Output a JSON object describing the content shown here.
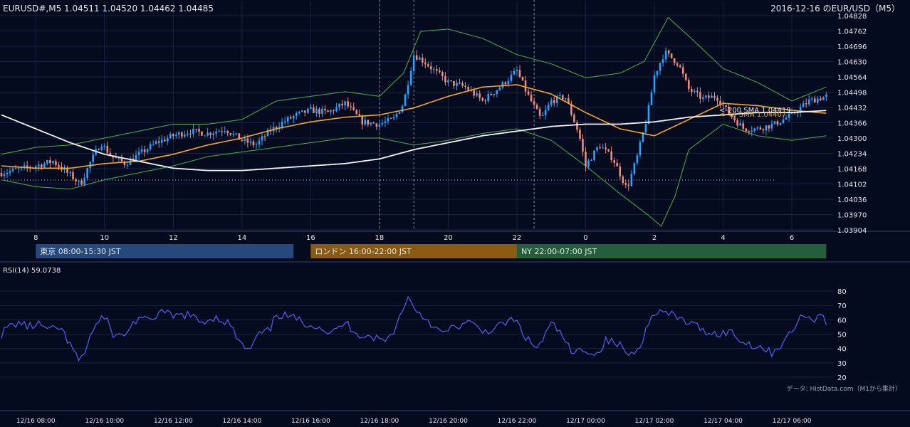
{
  "header": {
    "left": "EURUSD#,M5 1.04511 1.04520 1.04462 1.04485",
    "right": "2016-12-16 のEUR/USD（M5）"
  },
  "colors": {
    "bg": "#050b1f",
    "grid": "#1a2240",
    "bull": "#29a3ff",
    "bear": "#f08a7a",
    "sma200": "#f2f2f2",
    "sma40": "#f5a623",
    "boll": "#4caf50",
    "rsi": "#5560f0",
    "tokyo": "#24497a",
    "london": "#8a5a12",
    "ny": "#255e3a"
  },
  "sessions": [
    {
      "label": "東京 08:00-15:30 JST",
      "start": 8.0,
      "end": 15.5,
      "color": "#24497a"
    },
    {
      "label": "ロンドン 16:00-22:00 JST",
      "start": 16.0,
      "end": 22.0,
      "color": "#8a5a12"
    },
    {
      "label": "NY 22:00-07:00 JST",
      "start": 22.0,
      "end": 31.0,
      "color": "#255e3a"
    }
  ],
  "footer_note": "データ: HistData.com（M1から集計）",
  "chart_data": [
    {
      "type": "candlestick",
      "title": "EURUSD#,M5 1.04511 1.04520 1.04462 1.04485",
      "subtitle": "2016-12-16 のEUR/USD（M5）",
      "x_ticks": [
        "8",
        "10",
        "12",
        "14",
        "16",
        "18",
        "20",
        "22",
        "0",
        "2",
        "4",
        "6"
      ],
      "x_tick_hours": [
        8,
        10,
        12,
        14,
        16,
        18,
        20,
        22,
        24,
        26,
        28,
        30
      ],
      "xlim_hours": [
        7.0,
        31.2
      ],
      "y_ticks": [
        "1.04828",
        "1.04762",
        "1.04696",
        "1.04630",
        "1.04564",
        "1.04498",
        "1.04432",
        "1.04366",
        "1.04300",
        "1.04234",
        "1.04168",
        "1.04102",
        "1.04036",
        "1.03970",
        "1.03904"
      ],
      "ylim": [
        1.03904,
        1.04828
      ],
      "sma_labels": [
        "<-200 SMA 1.04419",
        "<-40 SMA 1.04407"
      ],
      "last_close": 1.04485,
      "dotted_level": 1.04119,
      "vlines_dashed": [
        18.0,
        19.0,
        22.5
      ],
      "price_path": [
        [
          7.0,
          1.0415
        ],
        [
          8.0,
          1.0418
        ],
        [
          8.5,
          1.042
        ],
        [
          9.0,
          1.0414
        ],
        [
          9.3,
          1.041
        ],
        [
          9.6,
          1.042
        ],
        [
          9.9,
          1.0428
        ],
        [
          10.2,
          1.0422
        ],
        [
          10.6,
          1.0419
        ],
        [
          11.0,
          1.0423
        ],
        [
          11.5,
          1.0428
        ],
        [
          12.0,
          1.0431
        ],
        [
          12.5,
          1.0433
        ],
        [
          13.0,
          1.0432
        ],
        [
          13.5,
          1.0434
        ],
        [
          14.0,
          1.0429
        ],
        [
          14.4,
          1.0427
        ],
        [
          14.8,
          1.0433
        ],
        [
          15.2,
          1.0437
        ],
        [
          15.6,
          1.044
        ],
        [
          16.0,
          1.0442
        ],
        [
          16.5,
          1.0441
        ],
        [
          17.0,
          1.0445
        ],
        [
          17.5,
          1.0437
        ],
        [
          18.0,
          1.0436
        ],
        [
          18.4,
          1.0438
        ],
        [
          18.7,
          1.0445
        ],
        [
          19.0,
          1.0466
        ],
        [
          19.3,
          1.0463
        ],
        [
          19.6,
          1.0459
        ],
        [
          20.0,
          1.0454
        ],
        [
          20.5,
          1.0452
        ],
        [
          21.0,
          1.0446
        ],
        [
          21.5,
          1.0452
        ],
        [
          22.0,
          1.0459
        ],
        [
          22.3,
          1.0449
        ],
        [
          22.7,
          1.0438
        ],
        [
          23.0,
          1.0446
        ],
        [
          23.4,
          1.0448
        ],
        [
          23.8,
          1.0432
        ],
        [
          24.0,
          1.0418
        ],
        [
          24.4,
          1.0427
        ],
        [
          24.8,
          1.0421
        ],
        [
          25.2,
          1.0408
        ],
        [
          25.5,
          1.0422
        ],
        [
          25.8,
          1.044
        ],
        [
          26.0,
          1.0457
        ],
        [
          26.3,
          1.0467
        ],
        [
          26.7,
          1.0462
        ],
        [
          27.0,
          1.0451
        ],
        [
          27.4,
          1.0447
        ],
        [
          27.8,
          1.0448
        ],
        [
          28.2,
          1.044
        ],
        [
          28.6,
          1.0434
        ],
        [
          29.0,
          1.0434
        ],
        [
          29.5,
          1.0436
        ],
        [
          30.0,
          1.044
        ],
        [
          30.5,
          1.0446
        ],
        [
          31.0,
          1.0448
        ]
      ],
      "sma200_path": [
        [
          7.0,
          1.044
        ],
        [
          8.0,
          1.0434
        ],
        [
          9.0,
          1.0428
        ],
        [
          10.0,
          1.0423
        ],
        [
          11.0,
          1.042
        ],
        [
          12.0,
          1.0417
        ],
        [
          13.0,
          1.0416
        ],
        [
          14.0,
          1.0416
        ],
        [
          15.0,
          1.0417
        ],
        [
          16.0,
          1.0418
        ],
        [
          17.0,
          1.0419
        ],
        [
          18.0,
          1.0421
        ],
        [
          19.0,
          1.0425
        ],
        [
          20.0,
          1.0428
        ],
        [
          21.0,
          1.0431
        ],
        [
          22.0,
          1.0433
        ],
        [
          23.0,
          1.0435
        ],
        [
          24.0,
          1.0436
        ],
        [
          25.0,
          1.0436
        ],
        [
          26.0,
          1.0437
        ],
        [
          27.0,
          1.0439
        ],
        [
          28.0,
          1.044
        ],
        [
          29.0,
          1.0441
        ],
        [
          30.0,
          1.0441
        ],
        [
          31.0,
          1.04419
        ]
      ],
      "sma40_path": [
        [
          7.0,
          1.0418
        ],
        [
          8.0,
          1.0417
        ],
        [
          9.0,
          1.0417
        ],
        [
          10.0,
          1.0419
        ],
        [
          11.0,
          1.042
        ],
        [
          12.0,
          1.0423
        ],
        [
          13.0,
          1.0427
        ],
        [
          14.0,
          1.043
        ],
        [
          15.0,
          1.0434
        ],
        [
          16.0,
          1.0437
        ],
        [
          17.0,
          1.0439
        ],
        [
          18.0,
          1.044
        ],
        [
          19.0,
          1.0443
        ],
        [
          20.0,
          1.0448
        ],
        [
          21.0,
          1.0452
        ],
        [
          22.0,
          1.0453
        ],
        [
          23.0,
          1.0449
        ],
        [
          24.0,
          1.0441
        ],
        [
          25.0,
          1.0434
        ],
        [
          26.0,
          1.0431
        ],
        [
          27.0,
          1.0438
        ],
        [
          28.0,
          1.0445
        ],
        [
          29.0,
          1.0444
        ],
        [
          30.0,
          1.0442
        ],
        [
          31.0,
          1.04407
        ]
      ],
      "boll_upper_path": [
        [
          7.0,
          1.0423
        ],
        [
          8.0,
          1.0426
        ],
        [
          9.0,
          1.0427
        ],
        [
          10.0,
          1.043
        ],
        [
          11.0,
          1.0433
        ],
        [
          12.0,
          1.0436
        ],
        [
          13.0,
          1.0436
        ],
        [
          14.0,
          1.0438
        ],
        [
          15.0,
          1.0446
        ],
        [
          16.0,
          1.0448
        ],
        [
          17.0,
          1.045
        ],
        [
          18.0,
          1.0448
        ],
        [
          18.7,
          1.0458
        ],
        [
          19.2,
          1.0476
        ],
        [
          20.0,
          1.0477
        ],
        [
          21.0,
          1.0473
        ],
        [
          22.0,
          1.0466
        ],
        [
          23.0,
          1.0462
        ],
        [
          24.0,
          1.0456
        ],
        [
          25.0,
          1.0458
        ],
        [
          25.7,
          1.0463
        ],
        [
          26.4,
          1.0482
        ],
        [
          27.0,
          1.0474
        ],
        [
          28.0,
          1.046
        ],
        [
          29.0,
          1.0454
        ],
        [
          30.0,
          1.0446
        ],
        [
          31.0,
          1.0452
        ]
      ],
      "boll_lower_path": [
        [
          7.0,
          1.0412
        ],
        [
          8.0,
          1.0409
        ],
        [
          9.0,
          1.0408
        ],
        [
          10.0,
          1.0412
        ],
        [
          11.0,
          1.0415
        ],
        [
          12.0,
          1.0418
        ],
        [
          13.0,
          1.0422
        ],
        [
          14.0,
          1.0424
        ],
        [
          15.0,
          1.0426
        ],
        [
          16.0,
          1.0428
        ],
        [
          17.0,
          1.043
        ],
        [
          18.0,
          1.043
        ],
        [
          19.0,
          1.0427
        ],
        [
          20.0,
          1.0429
        ],
        [
          21.0,
          1.0432
        ],
        [
          22.0,
          1.0434
        ],
        [
          23.0,
          1.0429
        ],
        [
          24.0,
          1.0418
        ],
        [
          25.0,
          1.0406
        ],
        [
          25.8,
          1.0397
        ],
        [
          26.2,
          1.0392
        ],
        [
          26.6,
          1.0405
        ],
        [
          27.0,
          1.0425
        ],
        [
          28.0,
          1.0436
        ],
        [
          29.0,
          1.0431
        ],
        [
          30.0,
          1.0429
        ],
        [
          31.0,
          1.0431
        ]
      ]
    },
    {
      "type": "line",
      "title": "RSI(14) 59.0738",
      "ylim": [
        20,
        80
      ],
      "y_ticks": [
        80,
        70,
        60,
        50,
        40,
        30,
        20
      ],
      "x_ticks": [
        "12/16 08:00",
        "12/16 10:00",
        "12/16 12:00",
        "12/16 14:00",
        "12/16 16:00",
        "12/16 18:00",
        "12/16 20:00",
        "12/16 22:00",
        "12/17 00:00",
        "12/17 02:00",
        "12/17 04:00",
        "12/17 06:00"
      ],
      "x_tick_hours": [
        8,
        10,
        12,
        14,
        16,
        18,
        20,
        22,
        24,
        26,
        28,
        30
      ],
      "series": [
        {
          "values_path": [
            [
              7.0,
              50
            ],
            [
              7.2,
              55
            ],
            [
              7.5,
              58
            ],
            [
              7.8,
              55
            ],
            [
              8.1,
              57
            ],
            [
              8.4,
              52
            ],
            [
              8.7,
              55
            ],
            [
              9.0,
              42
            ],
            [
              9.3,
              30
            ],
            [
              9.6,
              50
            ],
            [
              9.9,
              62
            ],
            [
              10.1,
              58
            ],
            [
              10.3,
              48
            ],
            [
              10.6,
              50
            ],
            [
              11.0,
              62
            ],
            [
              11.3,
              58
            ],
            [
              11.6,
              66
            ],
            [
              12.0,
              62
            ],
            [
              12.4,
              64
            ],
            [
              12.8,
              58
            ],
            [
              13.2,
              62
            ],
            [
              13.6,
              58
            ],
            [
              14.0,
              42
            ],
            [
              14.2,
              38
            ],
            [
              14.5,
              50
            ],
            [
              14.8,
              52
            ],
            [
              15.0,
              64
            ],
            [
              15.4,
              62
            ],
            [
              15.8,
              58
            ],
            [
              16.2,
              56
            ],
            [
              16.6,
              50
            ],
            [
              17.0,
              58
            ],
            [
              17.4,
              50
            ],
            [
              17.8,
              48
            ],
            [
              18.2,
              45
            ],
            [
              18.5,
              56
            ],
            [
              18.8,
              76
            ],
            [
              19.1,
              66
            ],
            [
              19.4,
              60
            ],
            [
              19.8,
              50
            ],
            [
              20.2,
              55
            ],
            [
              20.6,
              58
            ],
            [
              21.0,
              52
            ],
            [
              21.4,
              54
            ],
            [
              21.8,
              60
            ],
            [
              22.0,
              58
            ],
            [
              22.3,
              46
            ],
            [
              22.6,
              40
            ],
            [
              23.0,
              57
            ],
            [
              23.3,
              50
            ],
            [
              23.6,
              36
            ],
            [
              24.0,
              40
            ],
            [
              24.3,
              35
            ],
            [
              24.6,
              46
            ],
            [
              25.0,
              42
            ],
            [
              25.3,
              35
            ],
            [
              25.6,
              44
            ],
            [
              26.0,
              66
            ],
            [
              26.3,
              65
            ],
            [
              26.6,
              62
            ],
            [
              27.0,
              58
            ],
            [
              27.4,
              53
            ],
            [
              27.8,
              50
            ],
            [
              28.2,
              52
            ],
            [
              28.6,
              44
            ],
            [
              29.0,
              42
            ],
            [
              29.4,
              37
            ],
            [
              29.8,
              45
            ],
            [
              30.1,
              56
            ],
            [
              30.4,
              65
            ],
            [
              30.6,
              58
            ],
            [
              30.9,
              66
            ],
            [
              31.0,
              59
            ]
          ]
        }
      ]
    }
  ]
}
